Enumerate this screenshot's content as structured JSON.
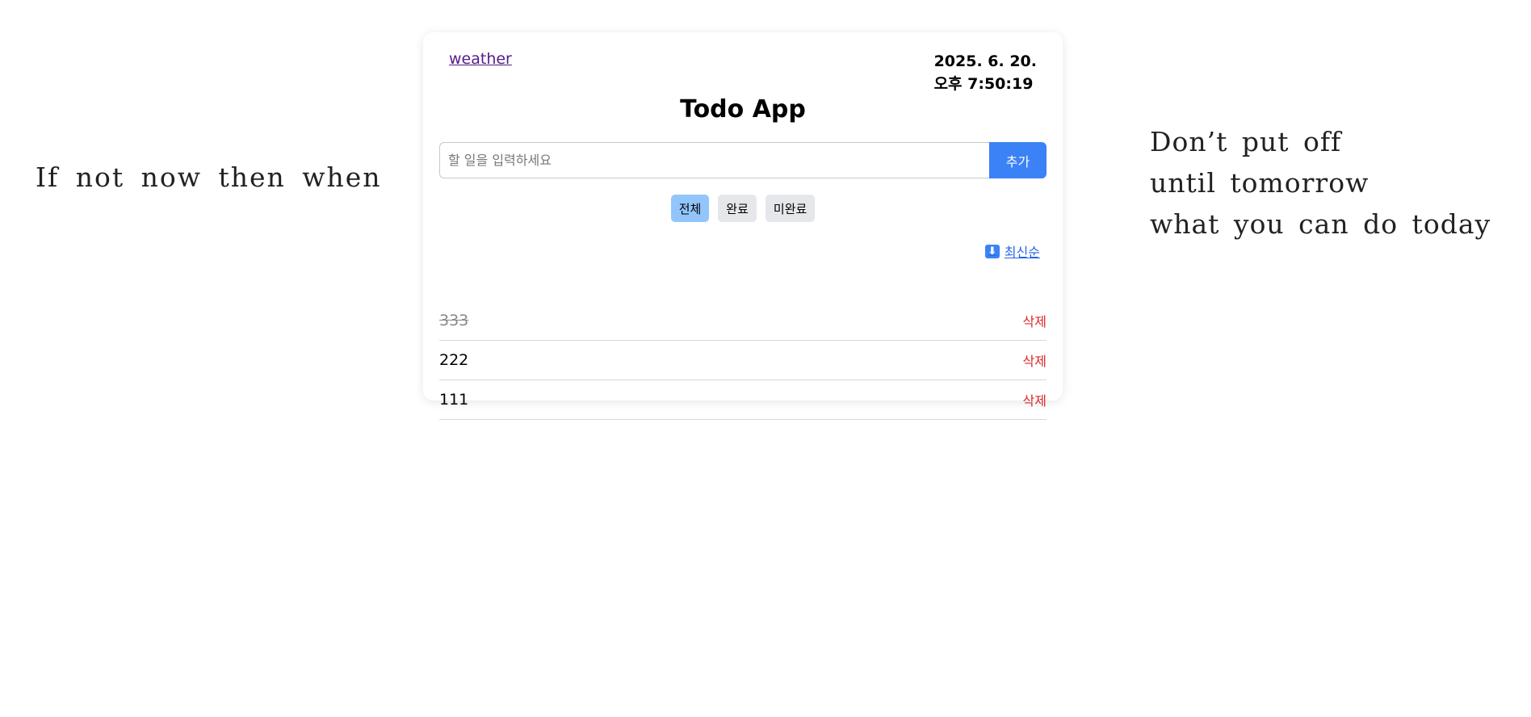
{
  "quotes": {
    "left": "If not now then when",
    "right": [
      "Don’t put off",
      "until tomorrow",
      "what you can do today"
    ]
  },
  "header": {
    "weather_link": "weather",
    "date": "2025. 6. 20.",
    "time": "오후 7:50:19"
  },
  "app": {
    "title": "Todo App"
  },
  "input": {
    "placeholder": "할 일을 입력하세요",
    "value": "",
    "add_label": "추가"
  },
  "filters": [
    {
      "label": "전체",
      "active": true
    },
    {
      "label": "완료",
      "active": false
    },
    {
      "label": "미완료",
      "active": false
    }
  ],
  "sort": {
    "icon": "down-arrow-icon",
    "icon_glyph": "⬇",
    "label": "최신순"
  },
  "todos": [
    {
      "text": "333",
      "done": true,
      "delete_label": "삭제"
    },
    {
      "text": "222",
      "done": false,
      "delete_label": "삭제"
    },
    {
      "text": "111",
      "done": false,
      "delete_label": "삭제"
    }
  ],
  "colors": {
    "accent": "#3b82f6",
    "active_filter": "#93c5fd",
    "delete": "#dc2626",
    "link_visited": "#551a8b"
  }
}
